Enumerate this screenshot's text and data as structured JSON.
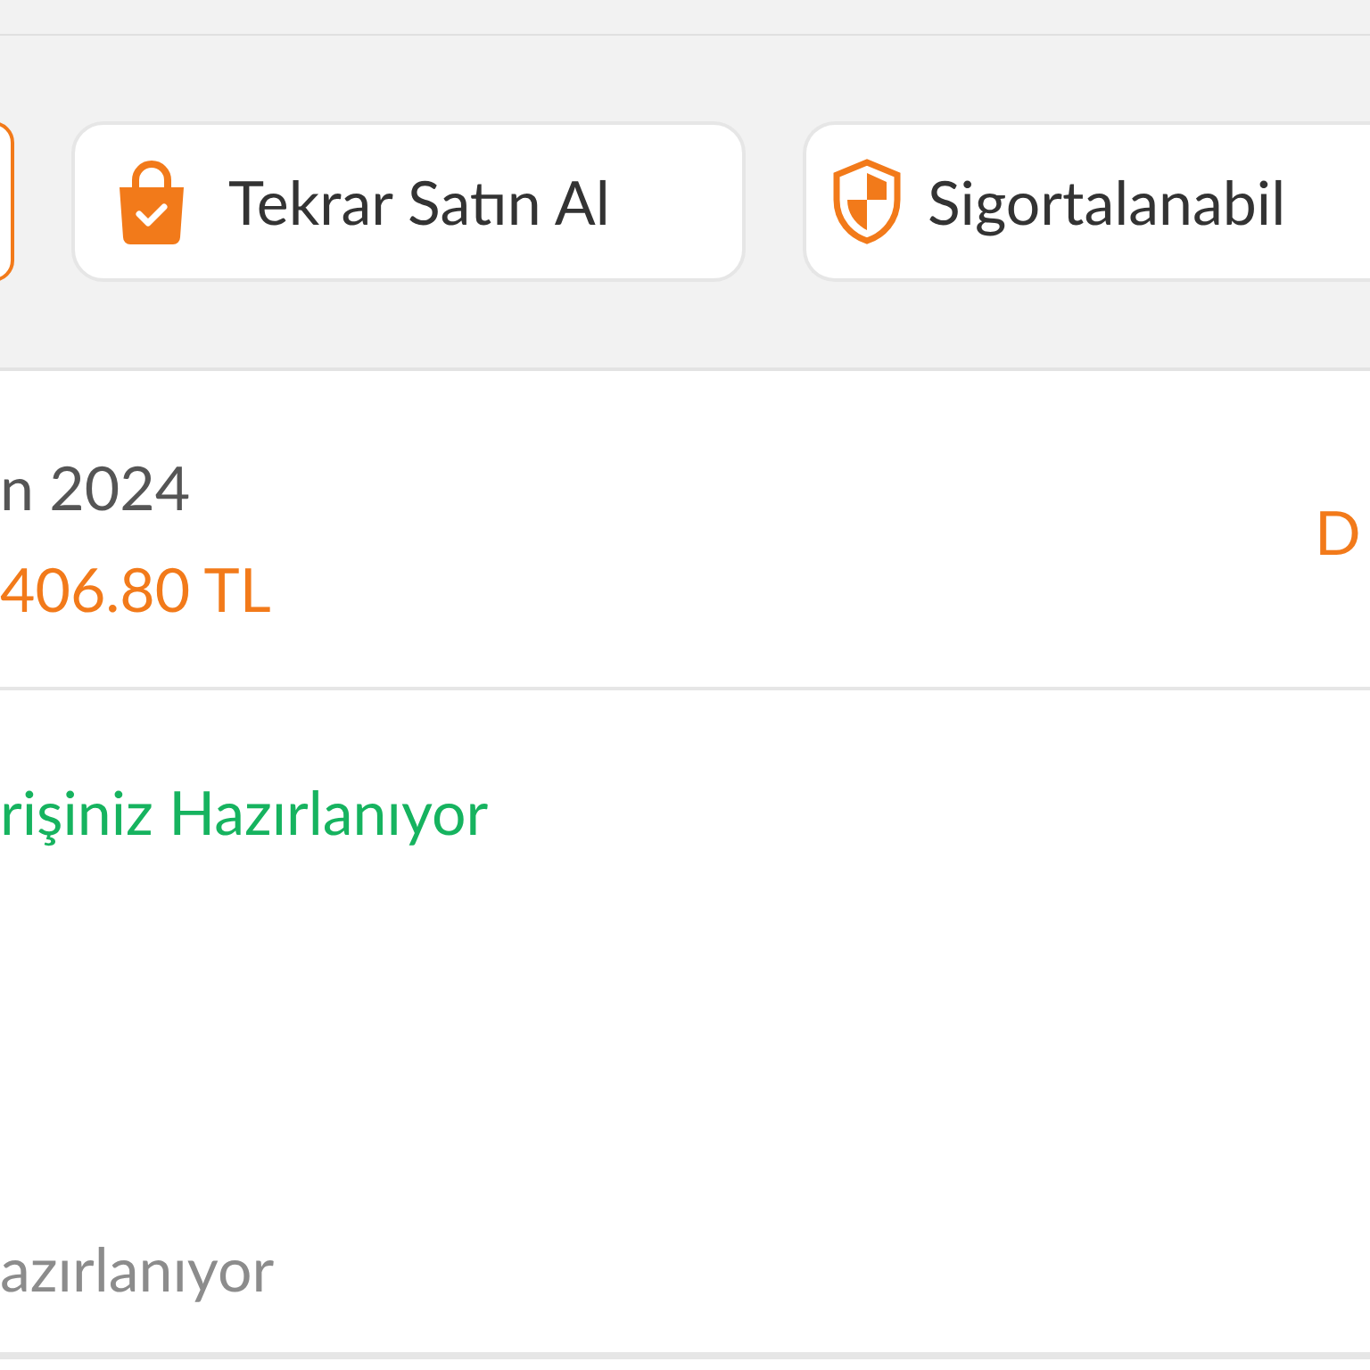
{
  "actions": [
    {
      "kind": "partial"
    },
    {
      "kind": "reorder",
      "label": "Tekrar Satın Al"
    },
    {
      "kind": "insurance",
      "label": "Sigortalanabil"
    }
  ],
  "order": {
    "date": "n 2024",
    "total": "406.80 TL",
    "link": "D"
  },
  "shipment": {
    "status": "rişiniz Hazırlanıyor",
    "note": "azırlanıyor"
  }
}
